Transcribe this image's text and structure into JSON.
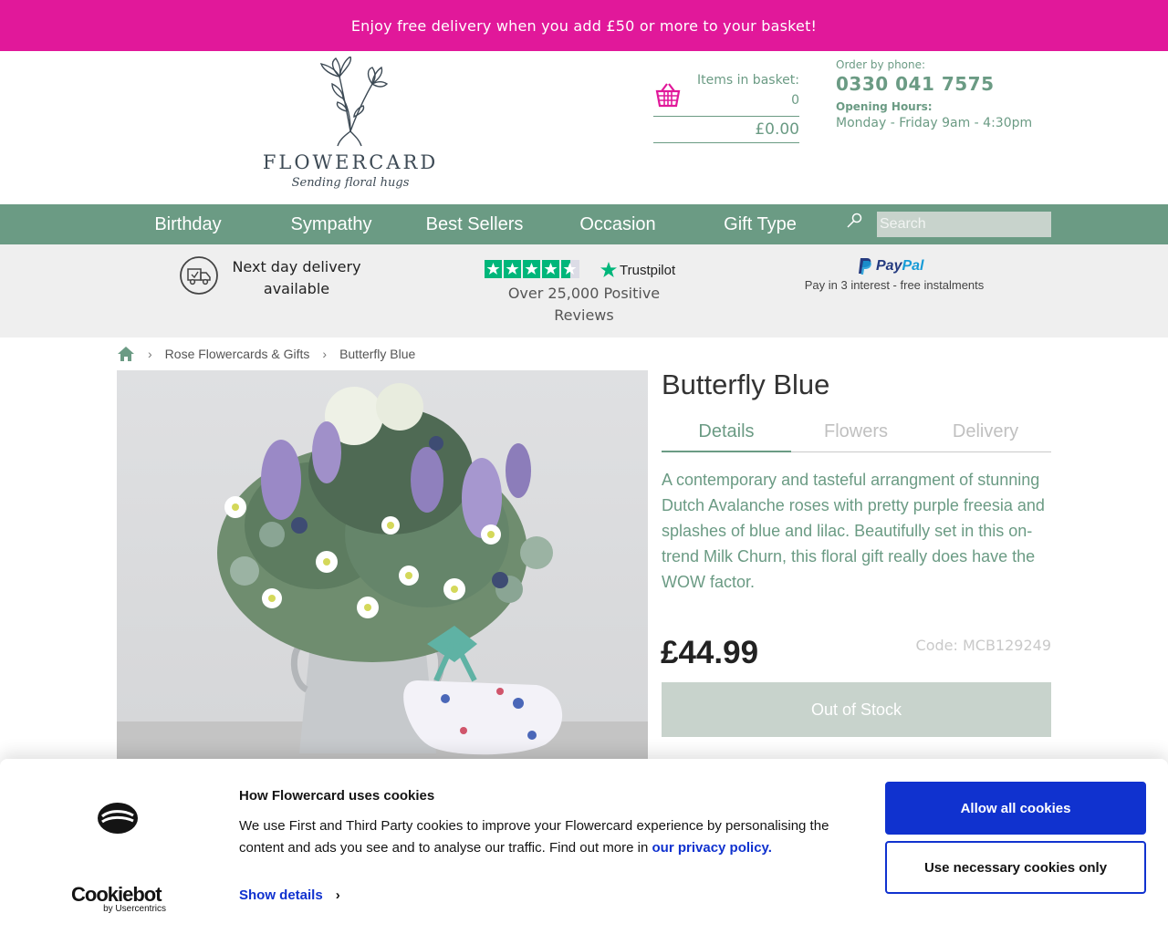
{
  "promo": {
    "text": "Enjoy free delivery when you add £50 or more to your basket!"
  },
  "header": {
    "logo": {
      "word": "FLOWERCARD",
      "tagline": "Sending floral hugs"
    },
    "basket": {
      "label": "Items in basket:",
      "count": "0",
      "total": "£0.00"
    },
    "phone": {
      "label": "Order by phone:",
      "number": "0330 041 7575",
      "hours_label": "Opening Hours:",
      "hours": "Monday - Friday 9am - 4:30pm"
    }
  },
  "nav": {
    "items": [
      "Birthday",
      "Sympathy",
      "Best Sellers",
      "Occasion",
      "Gift Type"
    ],
    "search_placeholder": "Search"
  },
  "usp": {
    "delivery": "Next day delivery available",
    "trustpilot_brand": "Trustpilot",
    "reviews": "Over 25,000 Positive Reviews",
    "paypal_pay": "Pay",
    "paypal_pal": "Pal",
    "paypal_sub": "Pay in 3 interest - free instalments"
  },
  "breadcrumb": [
    "Rose Flowercards & Gifts",
    "Butterfly Blue"
  ],
  "product": {
    "title": "Butterfly Blue",
    "tabs": [
      "Details",
      "Flowers",
      "Delivery"
    ],
    "active_tab": "Details",
    "description": "A contemporary and tasteful arrangment of stunning Dutch Avalanche roses with pretty purple freesia and splashes of blue and lilac. Beautifully set in this on-trend Milk Churn, this floral gift really does have the WOW factor.",
    "price": "£44.99",
    "code": "Code: MCB129249",
    "stock_button": "Out of Stock"
  },
  "cookie": {
    "title": "How Flowercard uses cookies",
    "text": "We use First and Third Party cookies to improve your Flowercard experience by personalising the content and ads you see and to analyse our traffic. Find out more in",
    "link": "our privacy policy.",
    "show_details": "Show details",
    "allow_all": "Allow all cookies",
    "necessary_only": "Use necessary cookies only",
    "brand": "Cookiebot",
    "brand_by": "by Usercentrics"
  },
  "colors": {
    "promo": "#e1189a",
    "brand_green": "#6b9b84",
    "cookie_blue": "#1032cf",
    "disabled_button": "#c8d3cc"
  }
}
